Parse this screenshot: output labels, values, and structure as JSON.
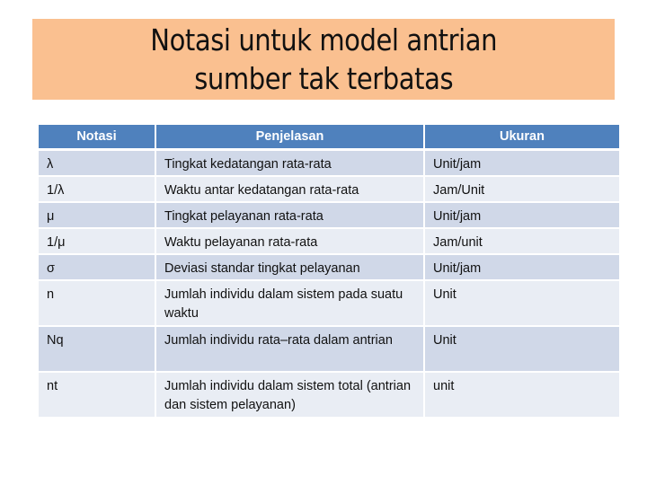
{
  "title": {
    "line1": "Notasi untuk model antrian",
    "line2": "sumber tak terbatas"
  },
  "table": {
    "headers": [
      "Notasi",
      "Penjelasan",
      "Ukuran"
    ],
    "rows": [
      {
        "notasi": "λ",
        "penjelasan": "Tingkat kedatangan rata-rata",
        "ukuran": "Unit/jam"
      },
      {
        "notasi": "1/λ",
        "penjelasan": "Waktu antar kedatangan rata-rata",
        "ukuran": "Jam/Unit"
      },
      {
        "notasi": "μ",
        "penjelasan": "Tingkat pelayanan rata-rata",
        "ukuran": "Unit/jam"
      },
      {
        "notasi": "1/μ",
        "penjelasan": "Waktu pelayanan rata-rata",
        "ukuran": "Jam/unit"
      },
      {
        "notasi": "σ",
        "penjelasan": "Deviasi standar tingkat pelayanan",
        "ukuran": "Unit/jam"
      },
      {
        "notasi": "n",
        "penjelasan": "Jumlah individu dalam sistem pada suatu waktu",
        "ukuran": "Unit"
      },
      {
        "notasi": "Nq",
        "penjelasan": "Jumlah individu rata–rata dalam antrian",
        "ukuran": "Unit"
      },
      {
        "notasi": "nt",
        "penjelasan": "Jumlah individu dalam sistem total (antrian dan sistem pelayanan)",
        "ukuran": "unit"
      }
    ]
  },
  "colors": {
    "title_bg": "#FAC090",
    "header_bg": "#4F81BD",
    "row_odd_bg": "#D0D8E8",
    "row_even_bg": "#E9EDF4"
  }
}
